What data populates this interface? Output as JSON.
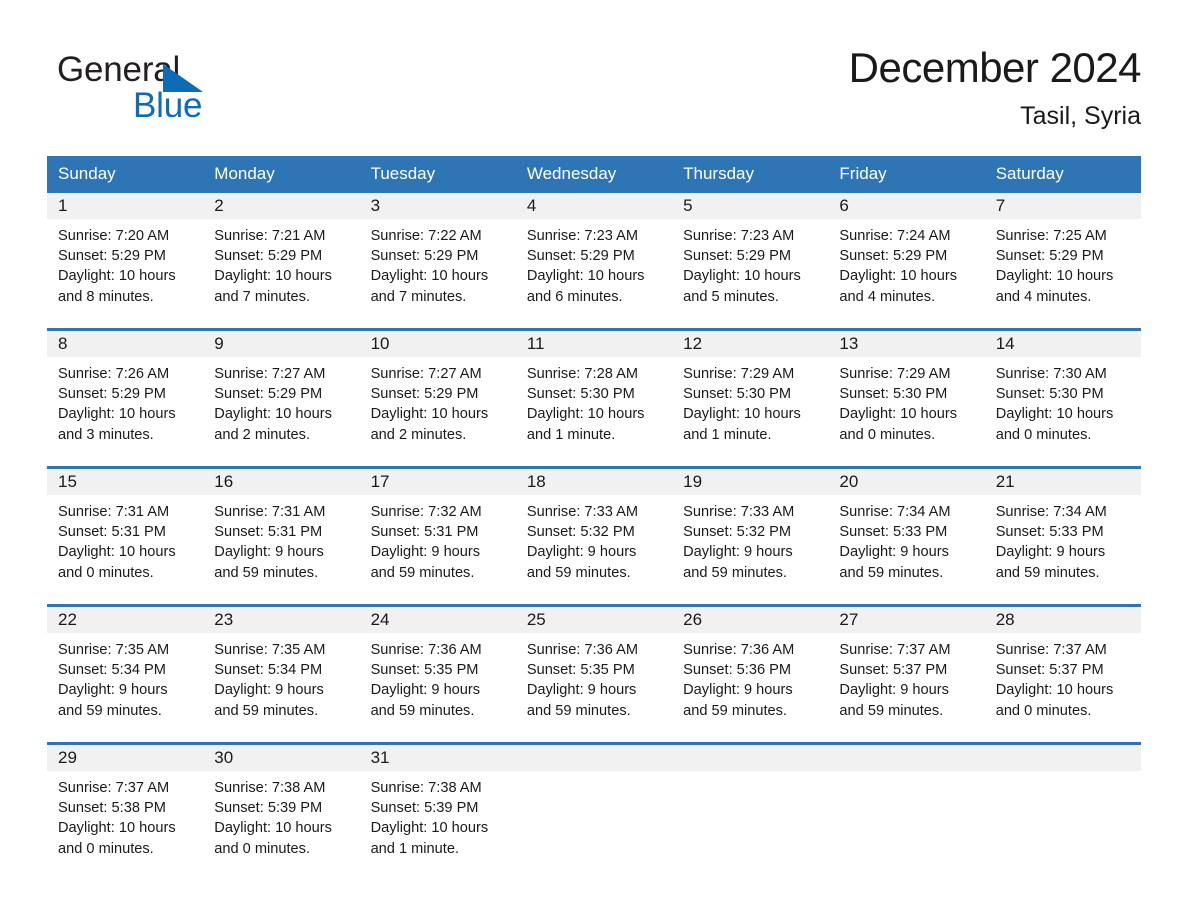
{
  "brand": {
    "name_dark": "General",
    "name_blue": "Blue",
    "accent_color": "#0d6cb5"
  },
  "header": {
    "title": "December 2024",
    "location": "Tasil, Syria"
  },
  "theme": {
    "header_blue": "#2e75b6",
    "daynum_band": "#f1f1f1",
    "text": "#1a1a1a"
  },
  "weekdays": [
    "Sunday",
    "Monday",
    "Tuesday",
    "Wednesday",
    "Thursday",
    "Friday",
    "Saturday"
  ],
  "weeks": [
    [
      {
        "day": "1",
        "sunrise": "Sunrise: 7:20 AM",
        "sunset": "Sunset: 5:29 PM",
        "daylight1": "Daylight: 10 hours",
        "daylight2": "and 8 minutes."
      },
      {
        "day": "2",
        "sunrise": "Sunrise: 7:21 AM",
        "sunset": "Sunset: 5:29 PM",
        "daylight1": "Daylight: 10 hours",
        "daylight2": "and 7 minutes."
      },
      {
        "day": "3",
        "sunrise": "Sunrise: 7:22 AM",
        "sunset": "Sunset: 5:29 PM",
        "daylight1": "Daylight: 10 hours",
        "daylight2": "and 7 minutes."
      },
      {
        "day": "4",
        "sunrise": "Sunrise: 7:23 AM",
        "sunset": "Sunset: 5:29 PM",
        "daylight1": "Daylight: 10 hours",
        "daylight2": "and 6 minutes."
      },
      {
        "day": "5",
        "sunrise": "Sunrise: 7:23 AM",
        "sunset": "Sunset: 5:29 PM",
        "daylight1": "Daylight: 10 hours",
        "daylight2": "and 5 minutes."
      },
      {
        "day": "6",
        "sunrise": "Sunrise: 7:24 AM",
        "sunset": "Sunset: 5:29 PM",
        "daylight1": "Daylight: 10 hours",
        "daylight2": "and 4 minutes."
      },
      {
        "day": "7",
        "sunrise": "Sunrise: 7:25 AM",
        "sunset": "Sunset: 5:29 PM",
        "daylight1": "Daylight: 10 hours",
        "daylight2": "and 4 minutes."
      }
    ],
    [
      {
        "day": "8",
        "sunrise": "Sunrise: 7:26 AM",
        "sunset": "Sunset: 5:29 PM",
        "daylight1": "Daylight: 10 hours",
        "daylight2": "and 3 minutes."
      },
      {
        "day": "9",
        "sunrise": "Sunrise: 7:27 AM",
        "sunset": "Sunset: 5:29 PM",
        "daylight1": "Daylight: 10 hours",
        "daylight2": "and 2 minutes."
      },
      {
        "day": "10",
        "sunrise": "Sunrise: 7:27 AM",
        "sunset": "Sunset: 5:29 PM",
        "daylight1": "Daylight: 10 hours",
        "daylight2": "and 2 minutes."
      },
      {
        "day": "11",
        "sunrise": "Sunrise: 7:28 AM",
        "sunset": "Sunset: 5:30 PM",
        "daylight1": "Daylight: 10 hours",
        "daylight2": "and 1 minute."
      },
      {
        "day": "12",
        "sunrise": "Sunrise: 7:29 AM",
        "sunset": "Sunset: 5:30 PM",
        "daylight1": "Daylight: 10 hours",
        "daylight2": "and 1 minute."
      },
      {
        "day": "13",
        "sunrise": "Sunrise: 7:29 AM",
        "sunset": "Sunset: 5:30 PM",
        "daylight1": "Daylight: 10 hours",
        "daylight2": "and 0 minutes."
      },
      {
        "day": "14",
        "sunrise": "Sunrise: 7:30 AM",
        "sunset": "Sunset: 5:30 PM",
        "daylight1": "Daylight: 10 hours",
        "daylight2": "and 0 minutes."
      }
    ],
    [
      {
        "day": "15",
        "sunrise": "Sunrise: 7:31 AM",
        "sunset": "Sunset: 5:31 PM",
        "daylight1": "Daylight: 10 hours",
        "daylight2": "and 0 minutes."
      },
      {
        "day": "16",
        "sunrise": "Sunrise: 7:31 AM",
        "sunset": "Sunset: 5:31 PM",
        "daylight1": "Daylight: 9 hours",
        "daylight2": "and 59 minutes."
      },
      {
        "day": "17",
        "sunrise": "Sunrise: 7:32 AM",
        "sunset": "Sunset: 5:31 PM",
        "daylight1": "Daylight: 9 hours",
        "daylight2": "and 59 minutes."
      },
      {
        "day": "18",
        "sunrise": "Sunrise: 7:33 AM",
        "sunset": "Sunset: 5:32 PM",
        "daylight1": "Daylight: 9 hours",
        "daylight2": "and 59 minutes."
      },
      {
        "day": "19",
        "sunrise": "Sunrise: 7:33 AM",
        "sunset": "Sunset: 5:32 PM",
        "daylight1": "Daylight: 9 hours",
        "daylight2": "and 59 minutes."
      },
      {
        "day": "20",
        "sunrise": "Sunrise: 7:34 AM",
        "sunset": "Sunset: 5:33 PM",
        "daylight1": "Daylight: 9 hours",
        "daylight2": "and 59 minutes."
      },
      {
        "day": "21",
        "sunrise": "Sunrise: 7:34 AM",
        "sunset": "Sunset: 5:33 PM",
        "daylight1": "Daylight: 9 hours",
        "daylight2": "and 59 minutes."
      }
    ],
    [
      {
        "day": "22",
        "sunrise": "Sunrise: 7:35 AM",
        "sunset": "Sunset: 5:34 PM",
        "daylight1": "Daylight: 9 hours",
        "daylight2": "and 59 minutes."
      },
      {
        "day": "23",
        "sunrise": "Sunrise: 7:35 AM",
        "sunset": "Sunset: 5:34 PM",
        "daylight1": "Daylight: 9 hours",
        "daylight2": "and 59 minutes."
      },
      {
        "day": "24",
        "sunrise": "Sunrise: 7:36 AM",
        "sunset": "Sunset: 5:35 PM",
        "daylight1": "Daylight: 9 hours",
        "daylight2": "and 59 minutes."
      },
      {
        "day": "25",
        "sunrise": "Sunrise: 7:36 AM",
        "sunset": "Sunset: 5:35 PM",
        "daylight1": "Daylight: 9 hours",
        "daylight2": "and 59 minutes."
      },
      {
        "day": "26",
        "sunrise": "Sunrise: 7:36 AM",
        "sunset": "Sunset: 5:36 PM",
        "daylight1": "Daylight: 9 hours",
        "daylight2": "and 59 minutes."
      },
      {
        "day": "27",
        "sunrise": "Sunrise: 7:37 AM",
        "sunset": "Sunset: 5:37 PM",
        "daylight1": "Daylight: 9 hours",
        "daylight2": "and 59 minutes."
      },
      {
        "day": "28",
        "sunrise": "Sunrise: 7:37 AM",
        "sunset": "Sunset: 5:37 PM",
        "daylight1": "Daylight: 10 hours",
        "daylight2": "and 0 minutes."
      }
    ],
    [
      {
        "day": "29",
        "sunrise": "Sunrise: 7:37 AM",
        "sunset": "Sunset: 5:38 PM",
        "daylight1": "Daylight: 10 hours",
        "daylight2": "and 0 minutes."
      },
      {
        "day": "30",
        "sunrise": "Sunrise: 7:38 AM",
        "sunset": "Sunset: 5:39 PM",
        "daylight1": "Daylight: 10 hours",
        "daylight2": "and 0 minutes."
      },
      {
        "day": "31",
        "sunrise": "Sunrise: 7:38 AM",
        "sunset": "Sunset: 5:39 PM",
        "daylight1": "Daylight: 10 hours",
        "daylight2": "and 1 minute."
      },
      {
        "day": "",
        "sunrise": "",
        "sunset": "",
        "daylight1": "",
        "daylight2": ""
      },
      {
        "day": "",
        "sunrise": "",
        "sunset": "",
        "daylight1": "",
        "daylight2": ""
      },
      {
        "day": "",
        "sunrise": "",
        "sunset": "",
        "daylight1": "",
        "daylight2": ""
      },
      {
        "day": "",
        "sunrise": "",
        "sunset": "",
        "daylight1": "",
        "daylight2": ""
      }
    ]
  ]
}
